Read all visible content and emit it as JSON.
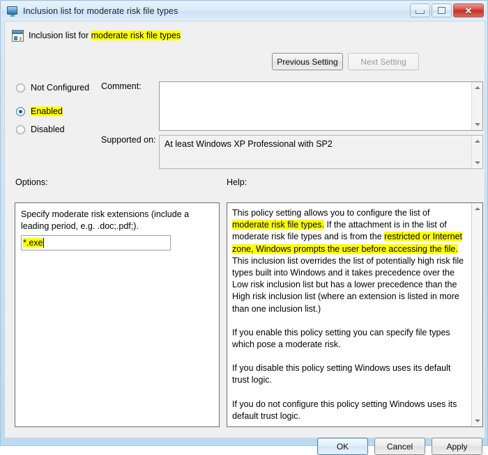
{
  "window": {
    "title": "Inclusion list for moderate risk file types",
    "title_icon": "monitor-icon",
    "minimize_label": "",
    "maximize_label": "",
    "close_label": "✕"
  },
  "header": {
    "icon": "policy-document-icon",
    "title_prefix": "Inclusion list for ",
    "title_highlight": "moderate risk file types",
    "previous_setting": "Previous Setting",
    "next_setting": "Next Setting"
  },
  "state_options": [
    {
      "label": "Not Configured",
      "checked": false,
      "highlighted": false
    },
    {
      "label": "Enabled",
      "checked": true,
      "highlighted": true
    },
    {
      "label": "Disabled",
      "checked": false,
      "highlighted": false
    }
  ],
  "comment": {
    "label": "Comment:",
    "value": ""
  },
  "supported_on": {
    "label": "Supported on:",
    "value": "At least Windows XP Professional with SP2"
  },
  "options": {
    "label": "Options:",
    "description": "Specify moderate risk extensions (include a leading period, e.g. .doc;.pdf;).",
    "input_value": "*.exe"
  },
  "help": {
    "label": "Help:",
    "paragraphs": [
      {
        "segments": [
          {
            "text": "This policy setting allows you to configure the list of ",
            "highlight": false
          },
          {
            "text": "moderate risk file types.",
            "highlight": true
          },
          {
            "text": " If the attachment is in the list of moderate risk file types and is from the ",
            "highlight": false
          },
          {
            "text": "restricted or Internet zone, Windows prompts the user before accessing the file.",
            "highlight": true
          },
          {
            "text": " This inclusion list overrides the list of potentially high risk file types built into Windows and it takes precedence over the Low risk inclusion list but has a lower precedence than the High risk inclusion list (where an extension is listed in more than one inclusion list.)",
            "highlight": false
          }
        ]
      },
      {
        "segments": [
          {
            "text": "If you enable this policy setting you can specify file types which pose a moderate risk.",
            "highlight": false
          }
        ]
      },
      {
        "segments": [
          {
            "text": "If you disable this policy setting Windows uses its default trust logic.",
            "highlight": false
          }
        ]
      },
      {
        "segments": [
          {
            "text": "If you do not configure this policy setting Windows uses its default trust logic.",
            "highlight": false
          }
        ]
      }
    ]
  },
  "actions": {
    "ok": "OK",
    "cancel": "Cancel",
    "apply": "Apply"
  },
  "colors": {
    "highlight": "#ffff00",
    "title_bar": "#dceaf7",
    "close_button": "#c22f26",
    "default_button_border": "#4b88b3"
  }
}
